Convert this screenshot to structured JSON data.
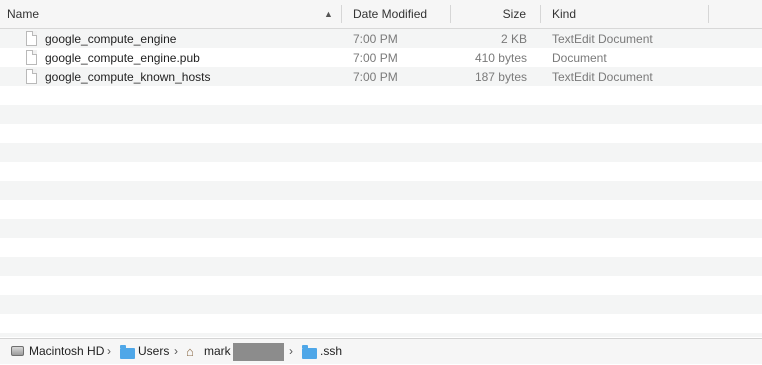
{
  "columns": {
    "name": "Name",
    "date_modified": "Date Modified",
    "size": "Size",
    "kind": "Kind"
  },
  "files": [
    {
      "name": "google_compute_engine",
      "date": "7:00 PM",
      "size": "2 KB",
      "kind": "TextEdit Document"
    },
    {
      "name": "google_compute_engine.pub",
      "date": "7:00 PM",
      "size": "410 bytes",
      "kind": "Document"
    },
    {
      "name": "google_compute_known_hosts",
      "date": "7:00 PM",
      "size": "187 bytes",
      "kind": "TextEdit Document"
    }
  ],
  "path": {
    "disk": "Macintosh HD",
    "users": "Users",
    "user": "mark",
    "folder": ".ssh"
  },
  "icons": {
    "file": "document-icon",
    "disk": "hard-disk-icon",
    "folder": "folder-icon",
    "home": "home-icon"
  },
  "colors": {
    "stripe": "#f4f5f5",
    "folder": "#4fa7e8"
  }
}
